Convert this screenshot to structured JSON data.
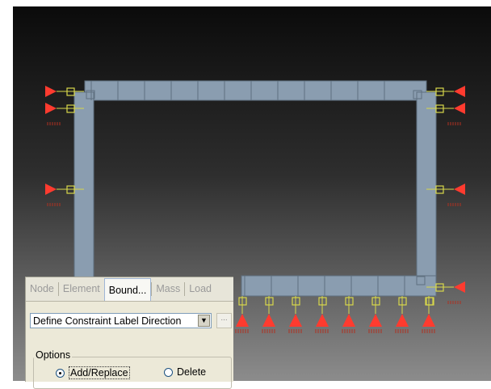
{
  "panel": {
    "tabs": [
      {
        "label": "Node",
        "active": false
      },
      {
        "label": "Element",
        "active": false
      },
      {
        "label": "Bound...",
        "active": true
      },
      {
        "label": "Mass",
        "active": false
      },
      {
        "label": "Load",
        "active": false
      }
    ],
    "command_select": {
      "value": "Define Constraint Label Direction",
      "arrow_icon": "chevron-down-icon"
    },
    "more_button": {
      "label": "..."
    },
    "options": {
      "legend": "Options",
      "add_replace": {
        "label": "Add/Replace",
        "checked": true
      },
      "delete": {
        "label": "Delete",
        "checked": false
      }
    }
  },
  "viewport": {
    "colors": {
      "beam": "#8a9db0",
      "beam_edge": "#5f7080",
      "support": "#ff3b2f",
      "node_marker": "#d8d84a",
      "support_hatch": "#b03020"
    }
  }
}
